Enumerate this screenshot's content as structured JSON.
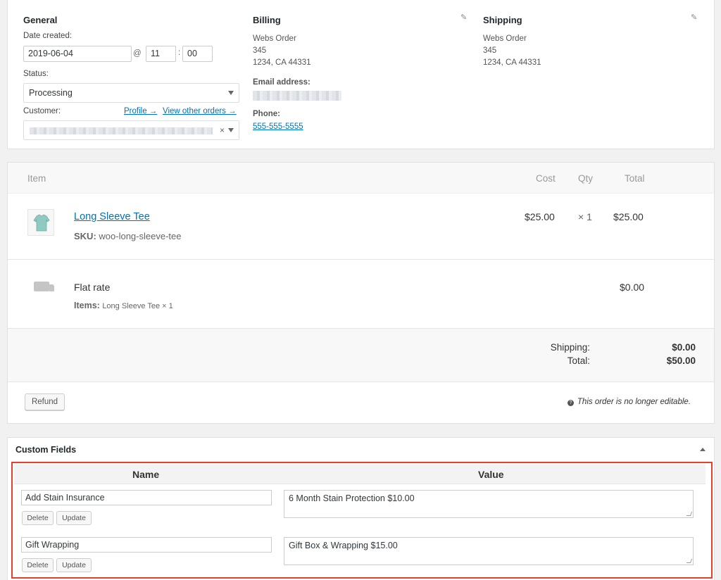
{
  "general": {
    "title": "General",
    "date_label": "Date created:",
    "date_value": "2019-06-04",
    "at": "@",
    "hour": "11",
    "colon": ":",
    "minute": "00",
    "status_label": "Status:",
    "status_value": "Processing",
    "customer_label": "Customer:",
    "profile_link": "Profile →",
    "other_orders_link": "View other orders →",
    "clear": "×"
  },
  "billing": {
    "title": "Billing",
    "address": [
      "Webs Order",
      "345",
      "1234, CA 44331"
    ],
    "email_label": "Email address:",
    "phone_label": "Phone:",
    "phone": "555-555-5555"
  },
  "shipping": {
    "title": "Shipping",
    "address": [
      "Webs Order",
      "345",
      "1234, CA 44331"
    ]
  },
  "items": {
    "headers": {
      "item": "Item",
      "cost": "Cost",
      "qty": "Qty",
      "total": "Total"
    },
    "product": {
      "name": "Long Sleeve Tee",
      "sku_label": "SKU:",
      "sku": "woo-long-sleeve-tee",
      "cost": "$25.00",
      "qty": "× 1",
      "total": "$25.00"
    },
    "shipping_line": {
      "name": "Flat rate",
      "items_label": "Items:",
      "items": "Long Sleeve Tee × 1",
      "total": "$0.00"
    },
    "totals": {
      "shipping_label": "Shipping:",
      "shipping_value": "$0.00",
      "total_label": "Total:",
      "total_value": "$50.00"
    },
    "refund_button": "Refund",
    "not_editable_note": "This order is no longer editable."
  },
  "custom_fields": {
    "title": "Custom Fields",
    "name_header": "Name",
    "value_header": "Value",
    "rows": [
      {
        "name": "Add Stain Insurance",
        "value": "6 Month Stain Protection $10.00",
        "delete": "Delete",
        "update": "Update"
      },
      {
        "name": "Gift Wrapping",
        "value": "Gift Box & Wrapping $15.00",
        "delete": "Delete",
        "update": "Update"
      }
    ]
  },
  "colors": {
    "link": "#0073aa",
    "highlight": "#e3402d"
  }
}
